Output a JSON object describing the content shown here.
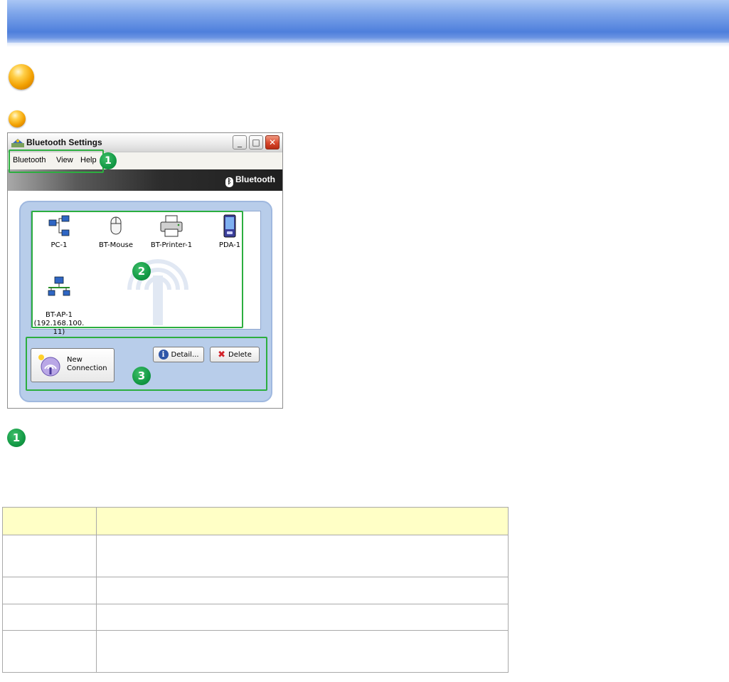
{
  "window": {
    "title": "Bluetooth Settings",
    "menu": [
      "Bluetooth",
      "View",
      "Help"
    ],
    "brand": "Bluetooth",
    "devices": [
      {
        "label": "PC-1",
        "icon": "computer-network-icon"
      },
      {
        "label": "BT-Mouse",
        "icon": "mouse-icon"
      },
      {
        "label": "BT-Printer-1",
        "icon": "printer-icon"
      },
      {
        "label": "PDA-1",
        "icon": "pda-icon"
      },
      {
        "label": "BT-AP-1\n(192.168.100.\n11)",
        "icon": "access-point-icon"
      }
    ],
    "buttons": {
      "new_connection": "New\nConnection",
      "detail": "Detail...",
      "delete": "Delete"
    }
  },
  "callouts": [
    "1",
    "2",
    "3"
  ],
  "section_marker": "1",
  "colors": {
    "callout_green": "#2cae3f",
    "banner_blue": "#4e7fdc",
    "table_header": "#ffffc6"
  }
}
